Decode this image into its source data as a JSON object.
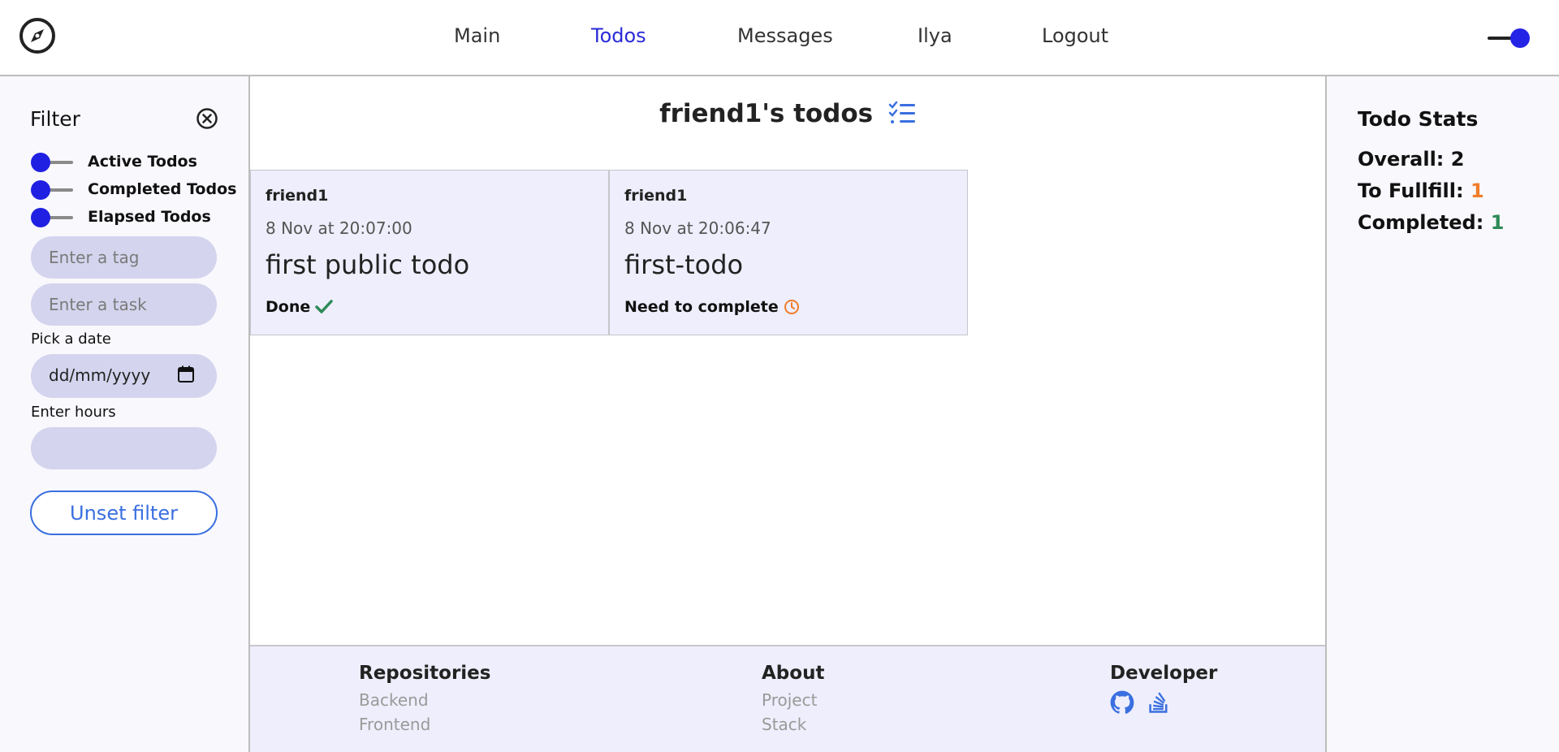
{
  "nav": {
    "items": [
      "Main",
      "Todos",
      "Messages",
      "Ilya",
      "Logout"
    ],
    "active": "Todos"
  },
  "filter": {
    "title": "Filter",
    "switches": [
      "Active Todos",
      "Completed Todos",
      "Elapsed Todos"
    ],
    "tag_placeholder": "Enter a tag",
    "task_placeholder": "Enter a task",
    "date_label": "Pick a date",
    "date_value": "dd/mm/yyyy",
    "hours_label": "Enter hours",
    "hours_value": "",
    "unset_label": "Unset filter"
  },
  "main": {
    "title": "friend1's todos",
    "cards": [
      {
        "user": "friend1",
        "time": "8 Nov at 20:07:00",
        "task": "first public todo",
        "status": "Done",
        "status_icon": "check-icon"
      },
      {
        "user": "friend1",
        "time": "8 Nov at 20:06:47",
        "task": "first-todo",
        "status": "Need to complete",
        "status_icon": "clock-icon"
      }
    ]
  },
  "footer": {
    "repositories": {
      "heading": "Repositories",
      "links": [
        "Backend",
        "Frontend"
      ]
    },
    "about": {
      "heading": "About",
      "links": [
        "Project",
        "Stack"
      ]
    },
    "developer": {
      "heading": "Developer",
      "icons": [
        "github-icon",
        "stackoverflow-icon"
      ]
    }
  },
  "stats": {
    "title": "Todo Stats",
    "overall_label": "Overall:",
    "overall_value": "2",
    "fulfill_label": "To Fullfill:",
    "fulfill_value": "1",
    "completed_label": "Completed:",
    "completed_value": "1"
  },
  "colors": {
    "accent": "#2a2ad8",
    "switch_knob": "#2020e2",
    "input_bg": "#d4d4ee",
    "card_bg": "#eeeefc",
    "done_green": "#2e8a57",
    "pending_orange": "#f07d2b"
  }
}
